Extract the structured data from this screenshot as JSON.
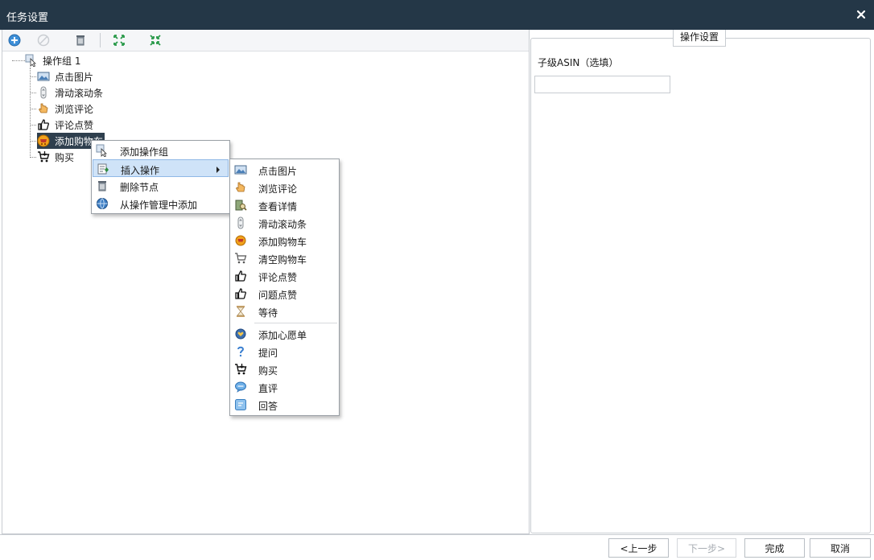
{
  "window": {
    "title": "任务设置",
    "close_icon": "close-icon"
  },
  "toolbar": {
    "buttons": [
      {
        "name": "add-button",
        "icon": "plus-circle-icon"
      },
      {
        "name": "disable-button",
        "icon": "ban-icon"
      },
      {
        "name": "delete-button",
        "icon": "trash-icon"
      },
      {
        "name": "expand-all-button",
        "icon": "expand-icon"
      },
      {
        "name": "collapse-all-button",
        "icon": "collapse-icon"
      }
    ]
  },
  "tree": {
    "root": {
      "label": "操作组 1",
      "icon": "cursor-group-icon"
    },
    "children": [
      {
        "label": "点击图片",
        "icon": "image-icon"
      },
      {
        "label": "滑动滚动条",
        "icon": "scroll-icon"
      },
      {
        "label": "浏览评论",
        "icon": "hand-icon"
      },
      {
        "label": "评论点赞",
        "icon": "thumbs-up-icon"
      },
      {
        "label": "添加购物车",
        "icon": "cart-add-icon",
        "selected": true
      },
      {
        "label": "购买",
        "icon": "cart-buy-icon"
      }
    ]
  },
  "context_menu": {
    "items": [
      {
        "label": "添加操作组",
        "icon": "cursor-group-icon"
      },
      {
        "label": "插入操作",
        "icon": "insert-icon",
        "submenu": true,
        "highlighted": true
      },
      {
        "label": "删除节点",
        "icon": "trash-icon"
      },
      {
        "label": "从操作管理中添加",
        "icon": "globe-icon"
      }
    ]
  },
  "submenu": {
    "items": [
      {
        "label": "点击图片",
        "icon": "image-icon"
      },
      {
        "label": "浏览评论",
        "icon": "hand-icon"
      },
      {
        "label": "查看详情",
        "icon": "details-icon"
      },
      {
        "label": "滑动滚动条",
        "icon": "scroll-icon"
      },
      {
        "label": "添加购物车",
        "icon": "cart-add-icon"
      },
      {
        "label": "清空购物车",
        "icon": "cart-empty-icon"
      },
      {
        "label": "评论点赞",
        "icon": "thumbs-up-icon"
      },
      {
        "label": "问题点赞",
        "icon": "thumbs-up-icon"
      },
      {
        "label": "等待",
        "icon": "hourglass-icon"
      },
      {
        "label": "添加心愿单",
        "icon": "wishlist-icon"
      },
      {
        "label": "提问",
        "icon": "question-icon"
      },
      {
        "label": "购买",
        "icon": "cart-buy-icon"
      },
      {
        "label": "直评",
        "icon": "chat-icon"
      },
      {
        "label": "回答",
        "icon": "answer-icon"
      }
    ]
  },
  "settings": {
    "legend": "操作设置",
    "field_label": "子级ASIN（选填）",
    "field_value": "",
    "field_placeholder": ""
  },
  "footer": {
    "prev": "<上一步",
    "next": "下一步>",
    "finish": "完成",
    "cancel": "取消"
  },
  "colors": {
    "titlebar": "#243747",
    "selection": "#2f3f4e",
    "menu_highlight": "#cfe3f8"
  }
}
